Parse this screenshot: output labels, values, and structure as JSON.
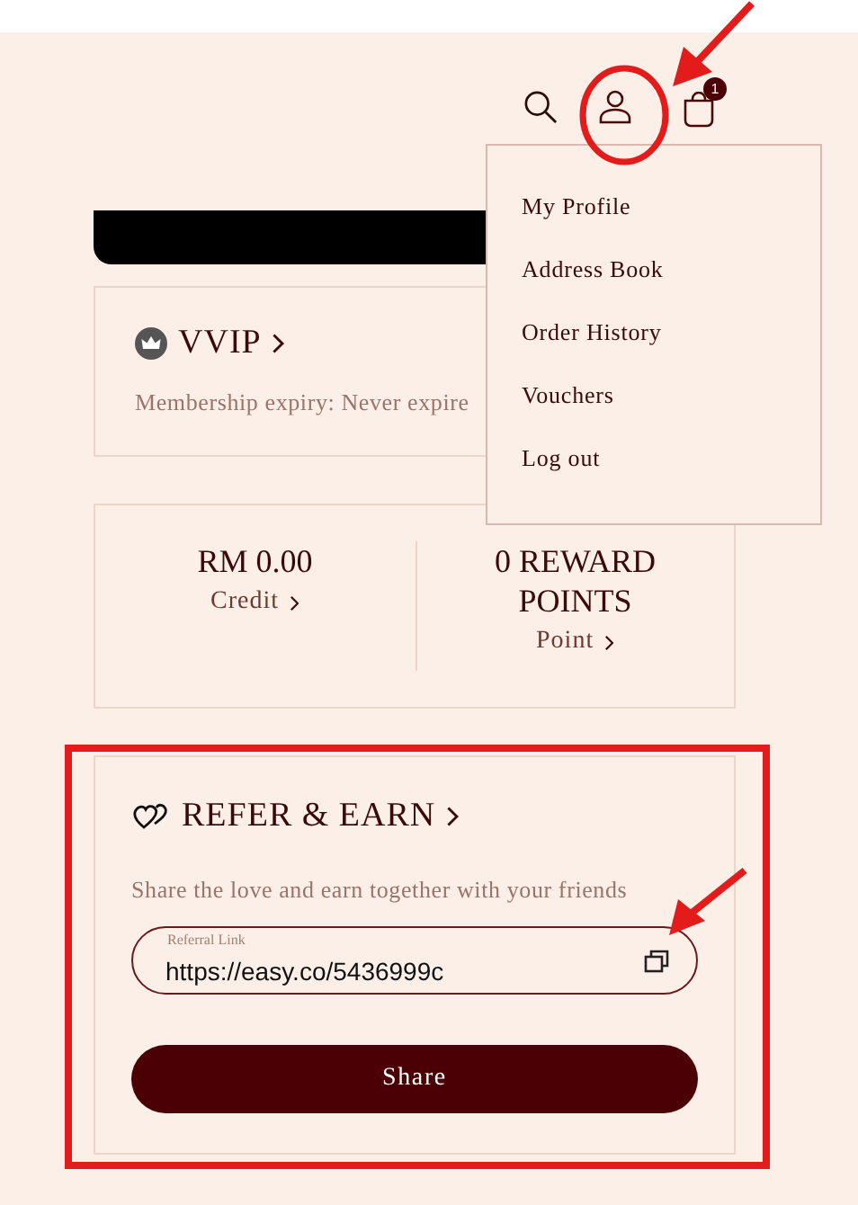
{
  "header": {
    "cart_count": "1"
  },
  "account_menu": {
    "items": [
      "My Profile",
      "Address Book",
      "Order History",
      "Vouchers",
      "Log out"
    ]
  },
  "membership": {
    "tier": "VVIP",
    "expiry": "Membership expiry: Never expire"
  },
  "balances": [
    {
      "amount": "RM 0.00",
      "link": "Credit"
    },
    {
      "amount": "0 REWARD POINTS",
      "link": "Point"
    }
  ],
  "referral": {
    "title": "REFER & EARN",
    "subtitle": "Share the love and earn together with your friends",
    "field_label": "Referral Link",
    "value": "https://easy.co/5436999c",
    "button": "Share"
  }
}
